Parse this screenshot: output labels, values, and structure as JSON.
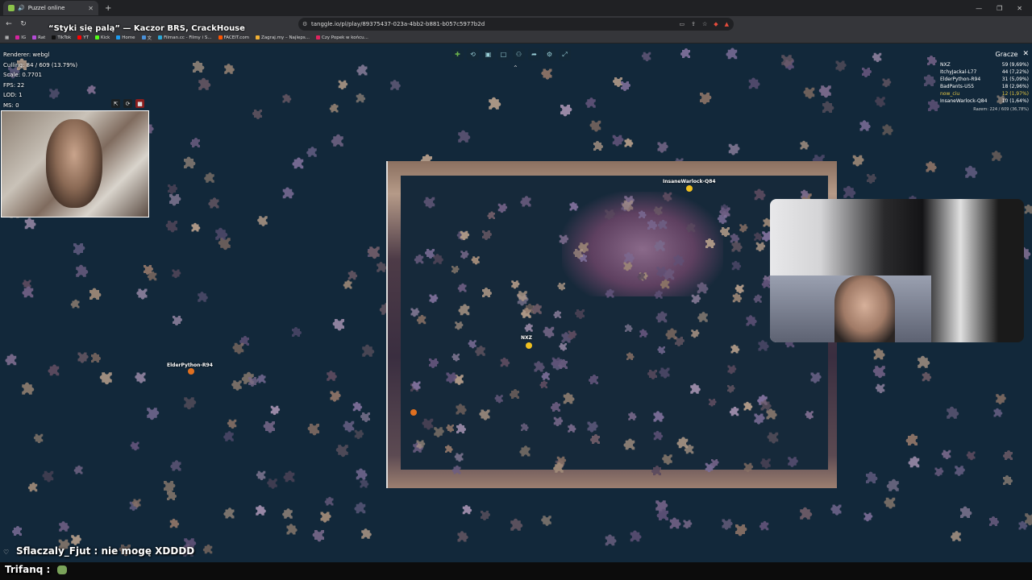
{
  "browser": {
    "tab_title": "Puzzel online",
    "url": "tanggle.io/pl/play/89375437-023a-4bb2-b881-b057c5977b2d",
    "overlay_title": "“Styki się palą” — Kaczor BRS, CrackHouse"
  },
  "bookmarks": [
    {
      "label": "IG",
      "color": "#d6249f"
    },
    {
      "label": "Rat",
      "color": "#b44cd6"
    },
    {
      "label": "TikTok",
      "color": "#111111"
    },
    {
      "label": "YT",
      "color": "#ff0000"
    },
    {
      "label": "Kick",
      "color": "#53fc18"
    },
    {
      "label": "Home",
      "color": "#1d9bf0"
    },
    {
      "label": "文",
      "color": "#4a90d9"
    },
    {
      "label": "Filman.cc - Filmy i S...",
      "color": "#2aa7d6"
    },
    {
      "label": "FACEIT.com",
      "color": "#ff5500"
    },
    {
      "label": "Zagraj.my – Najleps...",
      "color": "#f2b134"
    },
    {
      "label": "Czy Popek w końcu...",
      "color": "#e0245e"
    }
  ],
  "stats": {
    "renderer": "Renderer: webgl",
    "culling": "Culling: 84 / 609 (13.79%)",
    "scale": "Scale: 0.7701",
    "fps": "FPS: 22",
    "lod": "LOD: 1",
    "ms": "MS: 0"
  },
  "toolbar_icons": [
    "puzzle-piece-icon",
    "shuffle-icon",
    "box-icon",
    "blank-icon",
    "users-icon",
    "share-icon",
    "settings-icon",
    "fullscreen-icon"
  ],
  "scoreboard": {
    "title": "Gracze",
    "close": "✕",
    "players": [
      {
        "name": "NXZ",
        "score": "59 (9,69%)"
      },
      {
        "name": "ItchyJackal-L77",
        "score": "44 (7,22%)"
      },
      {
        "name": "ElderPython-R94",
        "score": "31 (5,09%)"
      },
      {
        "name": "BadPants-U55",
        "score": "18 (2,96%)"
      },
      {
        "name": "now_ciu",
        "score": "12 (1,97%)",
        "highlight": true
      },
      {
        "name": "InsaneWarlock-Q84",
        "score": "10 (1,64%)"
      }
    ],
    "total": "Razem: 224 / 609 (36,78%)"
  },
  "cursors": [
    {
      "name": "InsaneWarlock-Q84",
      "color": "#f0c020"
    },
    {
      "name": "NXZ",
      "color": "#f0c020"
    },
    {
      "name": "ElderPython-R94",
      "color": "#e07020"
    }
  ],
  "chat": {
    "line1_user": "Sflaczaly_Fjut",
    "line1_msg": " : nie mogę XDDDD",
    "line2_user": "Trifanq",
    "line2_msg": " : "
  }
}
